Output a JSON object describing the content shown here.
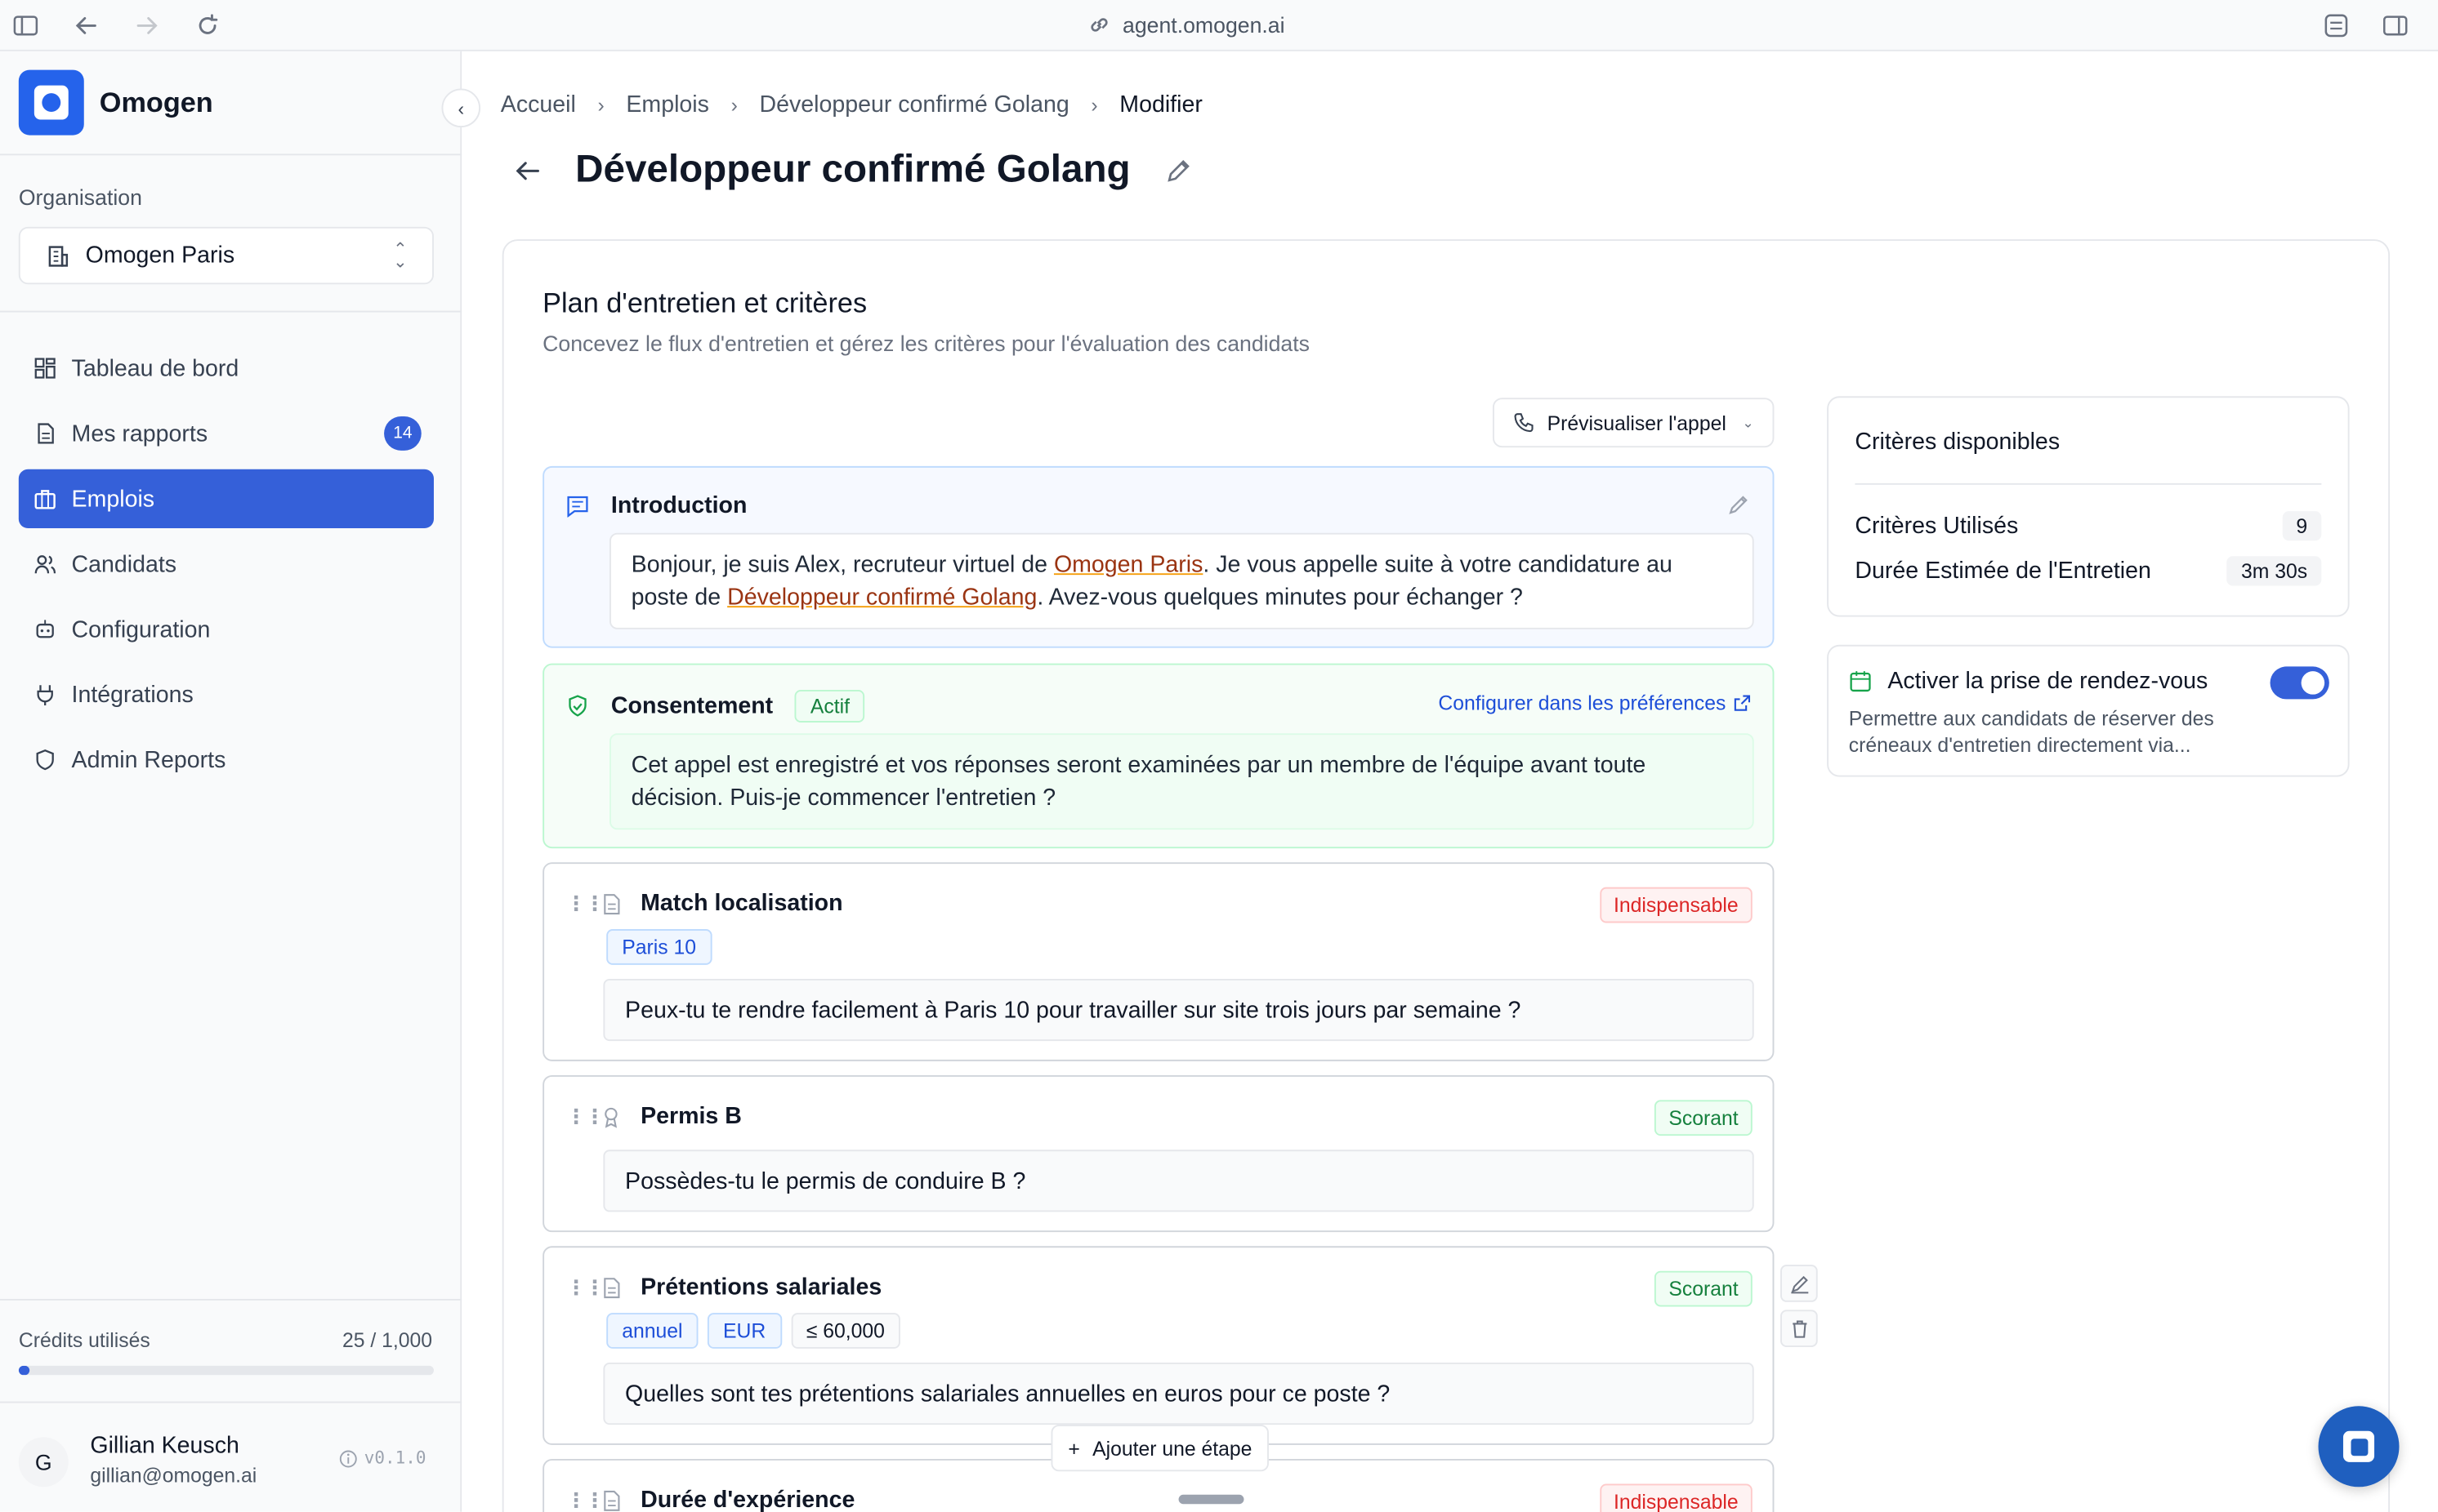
{
  "browser": {
    "url": "agent.omogen.ai"
  },
  "sidebar": {
    "brand": "Omogen",
    "org_label": "Organisation",
    "org_value": "Omogen Paris",
    "items": [
      {
        "label": "Tableau de bord",
        "icon": "dashboard-icon"
      },
      {
        "label": "Mes rapports",
        "icon": "report-icon",
        "badge": "14"
      },
      {
        "label": "Emplois",
        "icon": "briefcase-icon",
        "active": true
      },
      {
        "label": "Candidats",
        "icon": "users-icon"
      },
      {
        "label": "Configuration",
        "icon": "robot-icon"
      },
      {
        "label": "Intégrations",
        "icon": "plug-icon"
      },
      {
        "label": "Admin Reports",
        "icon": "shield-icon"
      }
    ],
    "credits_label": "Crédits utilisés",
    "credits_value": "25 / 1,000",
    "credits_fraction": 0.025,
    "user": {
      "initial": "G",
      "name": "Gillian Keusch",
      "email": "gillian@omogen.ai",
      "version": "v0.1.0"
    }
  },
  "breadcrumb": [
    "Accueil",
    "Emplois",
    "Développeur confirmé Golang",
    "Modifier"
  ],
  "page_title": "Développeur confirmé Golang",
  "plan": {
    "title": "Plan d'entretien et critères",
    "subtitle": "Concevez le flux d'entretien et gérez les critères pour l'évaluation des candidats",
    "preview_button": "Prévisualiser l'appel",
    "intro": {
      "title": "Introduction",
      "text_1": "Bonjour, je suis Alex, recruteur virtuel de ",
      "org": "Omogen Paris",
      "text_2": ". Je vous appelle suite à votre candidature au poste de ",
      "job": "Développeur confirmé Golang",
      "text_3": ". Avez-vous quelques minutes pour échanger ?"
    },
    "consent": {
      "title": "Consentement",
      "badge": "Actif",
      "link": "Configurer dans les préférences",
      "text": "Cet appel est enregistré et vos réponses seront examinées par un membre de l'équipe avant toute décision. Puis-je commencer l'entretien ?"
    },
    "criteria": [
      {
        "title": "Match localisation",
        "tag": "Indispensable",
        "chips": [
          "Paris 10"
        ],
        "question": "Peux-tu te rendre facilement à Paris 10 pour travailler sur site trois jours par semaine ?"
      },
      {
        "title": "Permis B",
        "tag": "Scorant",
        "chips": [],
        "question": "Possèdes-tu le permis de conduire B ?"
      },
      {
        "title": "Prétentions salariales",
        "tag": "Scorant",
        "chips": [
          "annuel",
          "EUR",
          "≤ 60,000"
        ],
        "question": "Quelles sont tes prétentions salariales annuelles en euros pour ce poste ?"
      },
      {
        "title": "Durée d'expérience",
        "tag": "Indispensable"
      }
    ],
    "add_step": "Ajouter une étape"
  },
  "side_panel": {
    "title": "Critères disponibles",
    "used_label": "Critères Utilisés",
    "used_value": "9",
    "duration_label": "Durée Estimée de l'Entretien",
    "duration_value": "3m 30s",
    "rdv_title": "Activer la prise de rendez-vous",
    "rdv_desc": "Permettre aux candidats de réserver des créneaux d'entretien directement via...",
    "rdv_enabled": true
  },
  "colors": {
    "accent": "#3560d9",
    "mandatory": "#dc2626",
    "scoring": "#15803d"
  }
}
